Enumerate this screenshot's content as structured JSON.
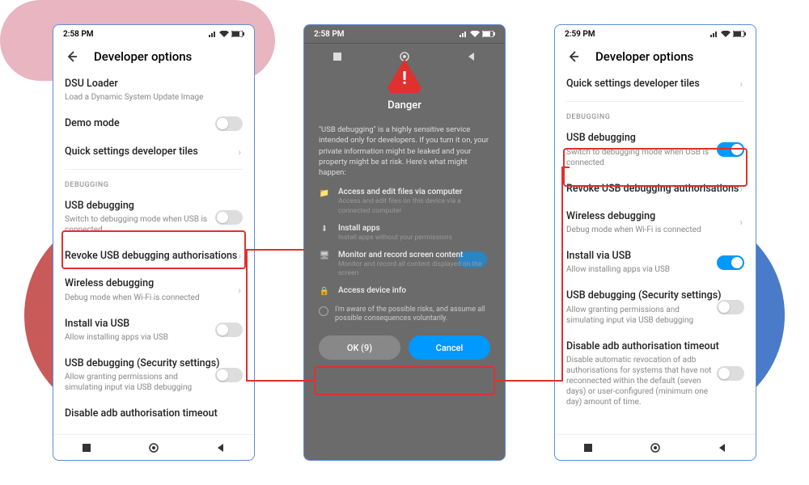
{
  "phone1": {
    "time": "2:58 PM",
    "title": "Developer options",
    "items": {
      "dsu_title": "DSU Loader",
      "dsu_sub": "Load a Dynamic System Update Image",
      "demo_title": "Demo mode",
      "quick_title": "Quick settings developer tiles",
      "section": "DEBUGGING",
      "usb_title": "USB debugging",
      "usb_sub": "Switch to debugging mode when USB is connected",
      "revoke_title": "Revoke USB debugging authorisations",
      "wireless_title": "Wireless debugging",
      "wireless_sub": "Debug mode when Wi-Fi is connected",
      "install_title": "Install via USB",
      "install_sub": "Allow installing apps via USB",
      "sec_title": "USB debugging (Security settings)",
      "sec_sub": "Allow granting permissions and simulating input via USB debugging",
      "disable_title": "Disable adb authorisation timeout"
    }
  },
  "phone2": {
    "time": "2:58 PM",
    "dialog": {
      "title": "Danger",
      "intro": "\"USB debugging\" is a highly sensitive service intended only for developers. If you turn it on, your private information might be leaked and your property might be at risk. Here's what might happen:",
      "r1_title": "Access and edit files via computer",
      "r1_sub": "Access and edit files on this device via a connected computer",
      "r2_title": "Install apps",
      "r2_sub": "Install apps without your permissions",
      "r3_title": "Monitor and record screen content",
      "r3_sub": "Monitor and record all content displayed on the screen",
      "r4_title": "Access device info",
      "check": "I'm aware of the possible risks, and assume all possible consequences voluntarily.",
      "ok": "OK (9)",
      "cancel": "Cancel"
    }
  },
  "phone3": {
    "time": "2:59 PM",
    "title": "Developer options",
    "items": {
      "quick_title": "Quick settings developer tiles",
      "section": "DEBUGGING",
      "usb_title": "USB debugging",
      "usb_sub": "Switch to debugging mode when USB is connected",
      "revoke_title": "Revoke USB debugging authorisations",
      "wireless_title": "Wireless debugging",
      "wireless_sub": "Debug mode when Wi-Fi is connected",
      "install_title": "Install via USB",
      "install_sub": "Allow installing apps via USB",
      "sec_title": "USB debugging (Security settings)",
      "sec_sub": "Allow granting permissions and simulating input via USB debugging",
      "disable_title": "Disable adb authorisation timeout",
      "disable_sub": "Disable automatic revocation of adb authorisations for systems that have not reconnected within the default (seven days) or user-configured (minimum one day) amount of time."
    }
  }
}
